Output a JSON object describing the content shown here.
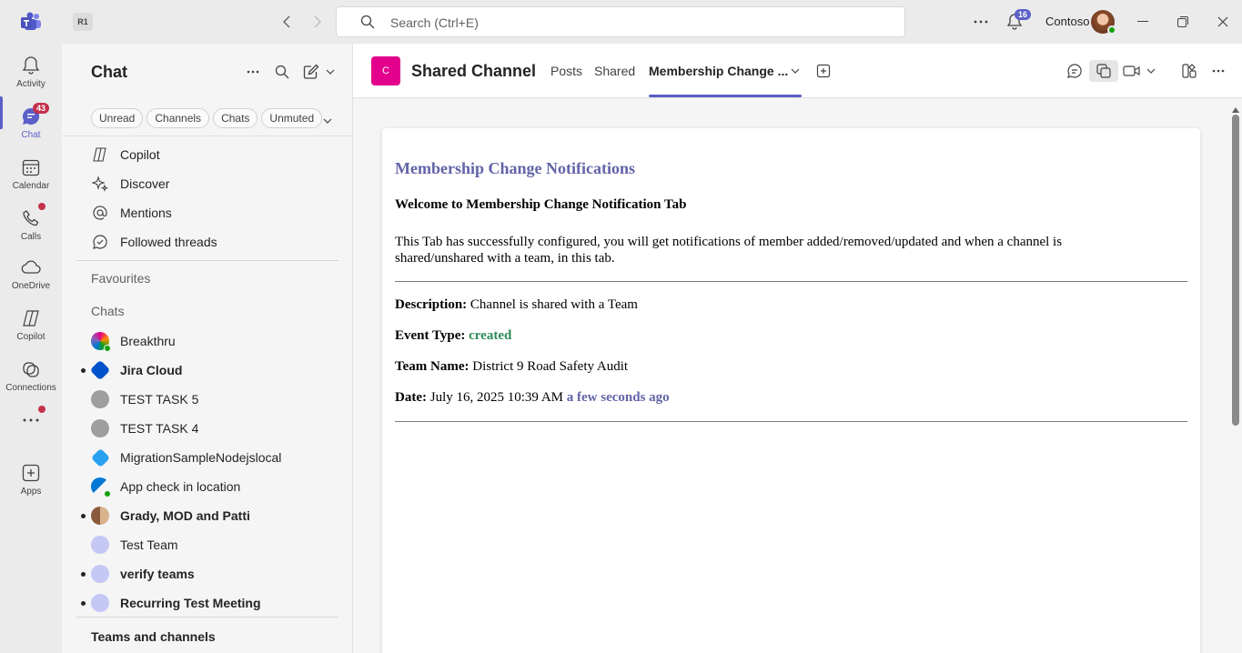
{
  "titlebar": {
    "account_badge": "R1",
    "search_placeholder": "Search (Ctrl+E)",
    "notifications_count": "16",
    "org_name": "Contoso"
  },
  "rail": {
    "items": [
      {
        "label": "Activity"
      },
      {
        "label": "Chat",
        "badge": "43"
      },
      {
        "label": "Calendar"
      },
      {
        "label": "Calls"
      },
      {
        "label": "OneDrive"
      },
      {
        "label": "Copilot"
      },
      {
        "label": "Connections"
      },
      {
        "label": "Apps"
      }
    ]
  },
  "chat_pane": {
    "title": "Chat",
    "filters": [
      "Unread",
      "Channels",
      "Chats",
      "Unmuted"
    ],
    "quick_links": [
      {
        "label": "Copilot",
        "icon": "copilot-icon"
      },
      {
        "label": "Discover",
        "icon": "sparkle-icon"
      },
      {
        "label": "Mentions",
        "icon": "at-icon"
      },
      {
        "label": "Followed threads",
        "icon": "followed-threads-icon"
      }
    ],
    "favourites_heading": "Favourites",
    "chats_heading": "Chats",
    "chats": [
      {
        "label": "Breakthru",
        "bold": false,
        "unread": false
      },
      {
        "label": "Jira Cloud",
        "bold": true,
        "unread": true
      },
      {
        "label": "TEST TASK 5",
        "bold": false,
        "unread": false
      },
      {
        "label": "TEST TASK 4",
        "bold": false,
        "unread": false
      },
      {
        "label": "MigrationSampleNodejslocal",
        "bold": false,
        "unread": false
      },
      {
        "label": "App check in location",
        "bold": false,
        "unread": false
      },
      {
        "label": "Grady, MOD and Patti",
        "bold": true,
        "unread": true
      },
      {
        "label": "Test Team",
        "bold": false,
        "unread": false
      },
      {
        "label": "verify teams",
        "bold": true,
        "unread": true
      },
      {
        "label": "Recurring Test Meeting",
        "bold": true,
        "unread": true
      }
    ],
    "teams_heading": "Teams and channels"
  },
  "channel": {
    "avatar_letter": "C",
    "name": "Shared Channel",
    "tabs": [
      "Posts",
      "Shared",
      "Membership Change ..."
    ],
    "active_tab": "Membership Change ..."
  },
  "tab_content": {
    "heading": "Membership Change Notifications",
    "welcome": "Welcome to Membership Change Notification Tab",
    "intro": "This Tab has successfully configured, you will get notifications of member added/removed/updated and when a channel is shared/unshared with a team, in this tab.",
    "description_label": "Description:",
    "description_value": "Channel is shared with a Team",
    "event_type_label": "Event Type:",
    "event_type_value": "created",
    "team_name_label": "Team Name:",
    "team_name_value": "District 9 Road Safety Audit",
    "date_label": "Date:",
    "date_value": "July 16, 2025 10:39 AM",
    "relative_time": "a few seconds ago"
  },
  "colors": {
    "brand": "#5b5fc7",
    "channel_avatar": "#e3008c",
    "event_type": "#2e8b57",
    "heading": "#6264a7"
  }
}
